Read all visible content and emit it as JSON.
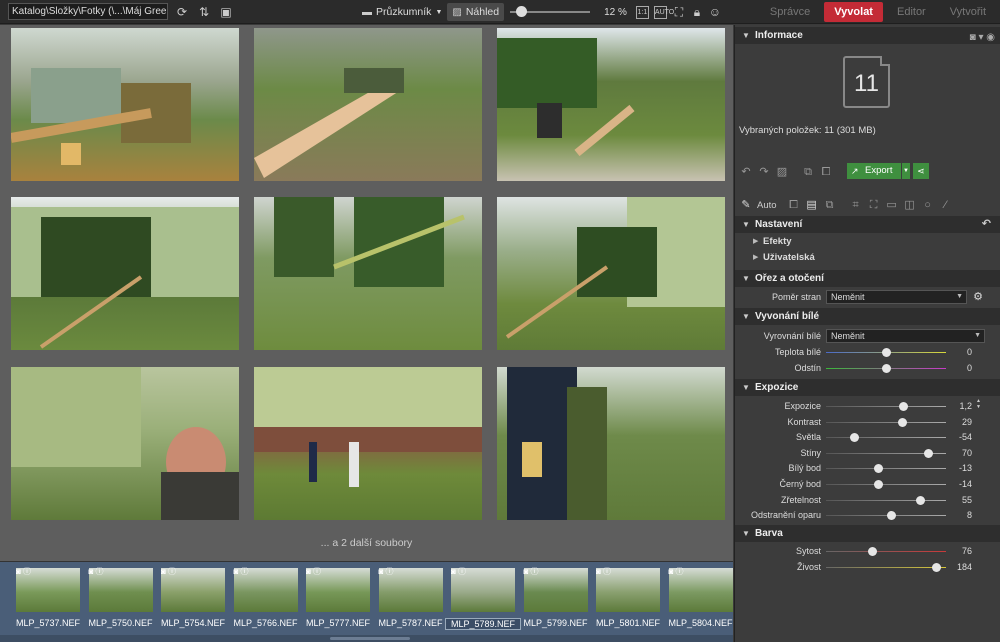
{
  "toolbar": {
    "path": "Katalog\\Složky\\Fotky (\\...\\Máj Green",
    "explorer_label": "Průzkumník",
    "preview_label": "Náhled",
    "zoom": "12 %",
    "ratio_label": "1:1",
    "fit_label": "AUTO"
  },
  "modes": {
    "manager": "Správce",
    "develop": "Vyvolat",
    "editor": "Editor",
    "create": "Vytvořit"
  },
  "browser": {
    "more_files": "... a 2 další soubory"
  },
  "filmstrip": {
    "items": [
      {
        "name": "MLP_5737.NEF"
      },
      {
        "name": "MLP_5750.NEF"
      },
      {
        "name": "MLP_5754.NEF"
      },
      {
        "name": "MLP_5766.NEF"
      },
      {
        "name": "MLP_5777.NEF"
      },
      {
        "name": "MLP_5787.NEF"
      },
      {
        "name": "MLP_5789.NEF"
      },
      {
        "name": "MLP_5799.NEF"
      },
      {
        "name": "MLP_5801.NEF"
      },
      {
        "name": "MLP_5804.NEF"
      }
    ]
  },
  "panel": {
    "info_title": "Informace",
    "count": "11",
    "selected_info": "Vybraných položek: 11 (301 MB)",
    "export_label": "Export",
    "auto_label": "Auto",
    "settings_title": "Nastavení",
    "effects_label": "Efekty",
    "user_label": "Uživatelská",
    "crop_title": "Ořez a otočení",
    "aspect_label": "Poměr stran",
    "aspect_value": "Neměnit",
    "wb_title": "Vyvonání bílé",
    "wb_label": "Vyrovnání bílé",
    "wb_value": "Neměnit",
    "temp_label": "Teplota bílé",
    "temp_value": "0",
    "tint_label": "Odstín",
    "tint_value": "0",
    "exposure_title": "Expozice",
    "exposure": [
      {
        "label": "Expozice",
        "value": "1,2",
        "pos": 0.64
      },
      {
        "label": "Kontrast",
        "value": "29",
        "pos": 0.63
      },
      {
        "label": "Světla",
        "value": "-54",
        "pos": 0.23
      },
      {
        "label": "Stíny",
        "value": "70",
        "pos": 0.85
      },
      {
        "label": "Bílý bod",
        "value": "-13",
        "pos": 0.43
      },
      {
        "label": "Černý bod",
        "value": "-14",
        "pos": 0.43
      },
      {
        "label": "Zřetelnost",
        "value": "55",
        "pos": 0.78
      },
      {
        "label": "Odstranění oparu",
        "value": "8",
        "pos": 0.54
      }
    ],
    "color_title": "Barva",
    "color": [
      {
        "label": "Sytost",
        "value": "76",
        "pos": 0.38
      },
      {
        "label": "Živost",
        "value": "184",
        "pos": 0.92
      }
    ]
  },
  "colors": {
    "accent": "#c42b36",
    "export_green": "#3f8f3f",
    "filmstrip_bg": "#4a5e78"
  }
}
